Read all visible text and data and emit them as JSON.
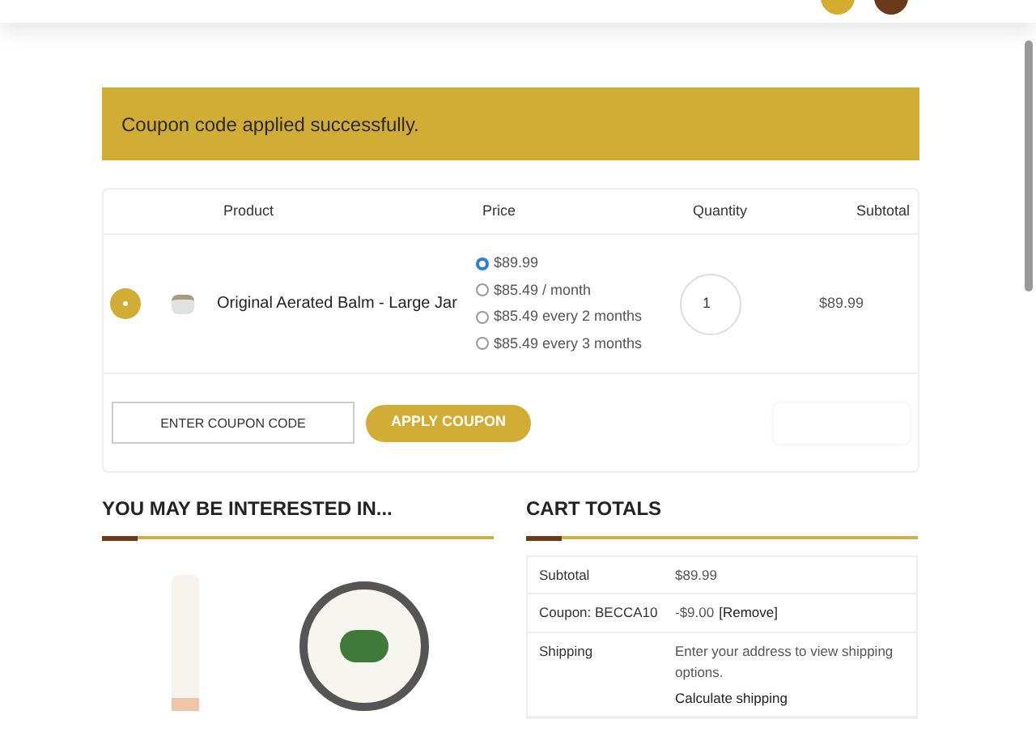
{
  "notice": {
    "message": "Coupon code applied successfully."
  },
  "cart": {
    "columns": [
      "Product",
      "Price",
      "Quantity",
      "Subtotal"
    ],
    "rows": [
      {
        "product": "Original Aerated Balm - Large Jar",
        "price_options": [
          {
            "label": "$89.99",
            "selected": true
          },
          {
            "label": "$85.49 / month",
            "selected": false
          },
          {
            "label": "$85.49 every 2 months",
            "selected": false
          },
          {
            "label": "$85.49 every 3 months",
            "selected": false
          }
        ],
        "quantity": "1",
        "subtotal": "$89.99"
      }
    ],
    "coupon_placeholder": "ENTER COUPON CODE",
    "apply_button": "APPLY COUPON"
  },
  "related": {
    "title": "YOU MAY BE INTERESTED IN..."
  },
  "totals": {
    "title": "CART TOTALS",
    "rows": [
      {
        "label": "Subtotal",
        "value": "$89.99"
      },
      {
        "label": "Coupon: BECCA10",
        "value": "-$9.00",
        "link": "[Remove]"
      },
      {
        "label": "Shipping",
        "value": "Enter your address to view shipping options.",
        "link": "Calculate shipping"
      }
    ]
  }
}
